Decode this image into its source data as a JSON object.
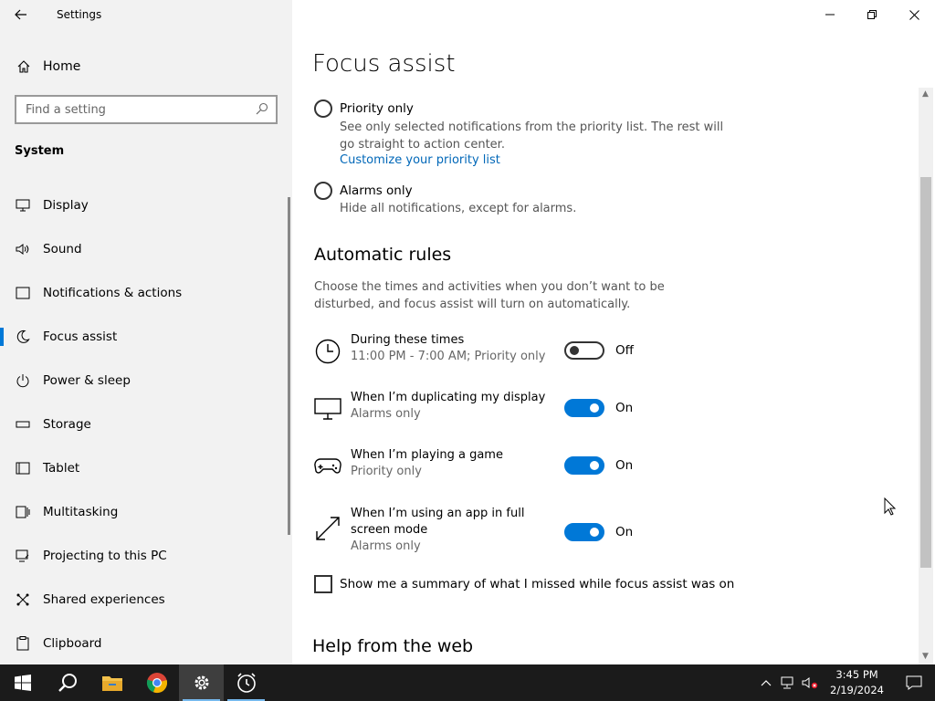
{
  "window": {
    "app_title": "Settings"
  },
  "sidebar": {
    "home_label": "Home",
    "search_placeholder": "Find a setting",
    "section_title": "System",
    "items": [
      {
        "label": "Display",
        "icon": "monitor-icon"
      },
      {
        "label": "Sound",
        "icon": "speaker-icon"
      },
      {
        "label": "Notifications & actions",
        "icon": "notification-icon"
      },
      {
        "label": "Focus assist",
        "icon": "moon-icon",
        "active": true
      },
      {
        "label": "Power & sleep",
        "icon": "power-icon"
      },
      {
        "label": "Storage",
        "icon": "storage-icon"
      },
      {
        "label": "Tablet",
        "icon": "tablet-icon"
      },
      {
        "label": "Multitasking",
        "icon": "multitasking-icon"
      },
      {
        "label": "Projecting to this PC",
        "icon": "projecting-icon"
      },
      {
        "label": "Shared experiences",
        "icon": "shared-icon"
      },
      {
        "label": "Clipboard",
        "icon": "clipboard-icon"
      }
    ]
  },
  "main": {
    "title": "Focus assist",
    "priority": {
      "label": "Priority only",
      "description": "See only selected notifications from the priority list. The rest will go straight to action center.",
      "link": "Customize your priority list"
    },
    "alarms": {
      "label": "Alarms only",
      "description": "Hide all notifications, except for alarms."
    },
    "automatic_rules": {
      "heading": "Automatic rules",
      "description": "Choose the times and activities when you don’t want to be disturbed, and focus assist will turn on automatically.",
      "rules": [
        {
          "name": "During these times",
          "sub": "11:00 PM - 7:00 AM; Priority only",
          "state": "Off",
          "icon": "clock-icon"
        },
        {
          "name": "When I’m duplicating my display",
          "sub": "Alarms only",
          "state": "On",
          "icon": "display-icon"
        },
        {
          "name": "When I’m playing a game",
          "sub": "Priority only",
          "state": "On",
          "icon": "gamepad-icon"
        },
        {
          "name": "When I’m using an app in full screen mode",
          "sub": "Alarms only",
          "state": "On",
          "icon": "fullscreen-icon"
        }
      ]
    },
    "summary_checkbox": "Show me a summary of what I missed while focus assist was on",
    "help_heading": "Help from the web"
  },
  "taskbar": {
    "time": "3:45 PM",
    "date": "2/19/2024"
  },
  "colors": {
    "accent": "#0078d7",
    "link": "#0067b8",
    "sidebar_bg": "#f2f2f2",
    "taskbar_bg": "#1b1b1b"
  }
}
